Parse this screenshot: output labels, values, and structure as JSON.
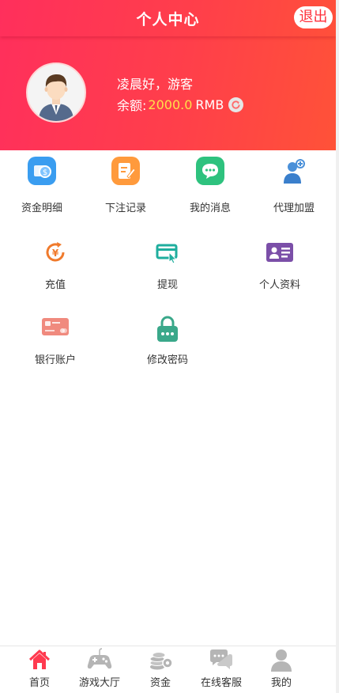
{
  "header": {
    "title": "个人中心",
    "logout_label": "退出",
    "greeting": "凌晨好，游客",
    "balance_label": "余额:",
    "balance_value": "2000.0",
    "balance_unit": "RMB"
  },
  "menu_row1": [
    {
      "label": "资金明细",
      "icon": "fund-detail-icon"
    },
    {
      "label": "下注记录",
      "icon": "bet-record-icon"
    },
    {
      "label": "我的消息",
      "icon": "message-icon"
    },
    {
      "label": "代理加盟",
      "icon": "agent-join-icon"
    }
  ],
  "menu_row2": [
    {
      "label": "充值",
      "icon": "recharge-icon"
    },
    {
      "label": "提现",
      "icon": "withdraw-icon"
    },
    {
      "label": "个人资料",
      "icon": "profile-card-icon"
    }
  ],
  "menu_row3": [
    {
      "label": "银行账户",
      "icon": "bank-card-icon"
    },
    {
      "label": "修改密码",
      "icon": "lock-icon"
    }
  ],
  "tabbar": [
    {
      "label": "首页",
      "icon": "home-icon",
      "active": true
    },
    {
      "label": "游戏大厅",
      "icon": "gamepad-icon",
      "active": false
    },
    {
      "label": "资金",
      "icon": "coins-icon",
      "active": false
    },
    {
      "label": "在线客服",
      "icon": "chat-icon",
      "active": false
    },
    {
      "label": "我的",
      "icon": "user-icon",
      "active": false
    }
  ],
  "colors": {
    "accent": "#ff3a4f",
    "balance": "#ffe04a",
    "active_tab": "#ff3a4f",
    "inactive_tab": "#b5b5b5"
  }
}
